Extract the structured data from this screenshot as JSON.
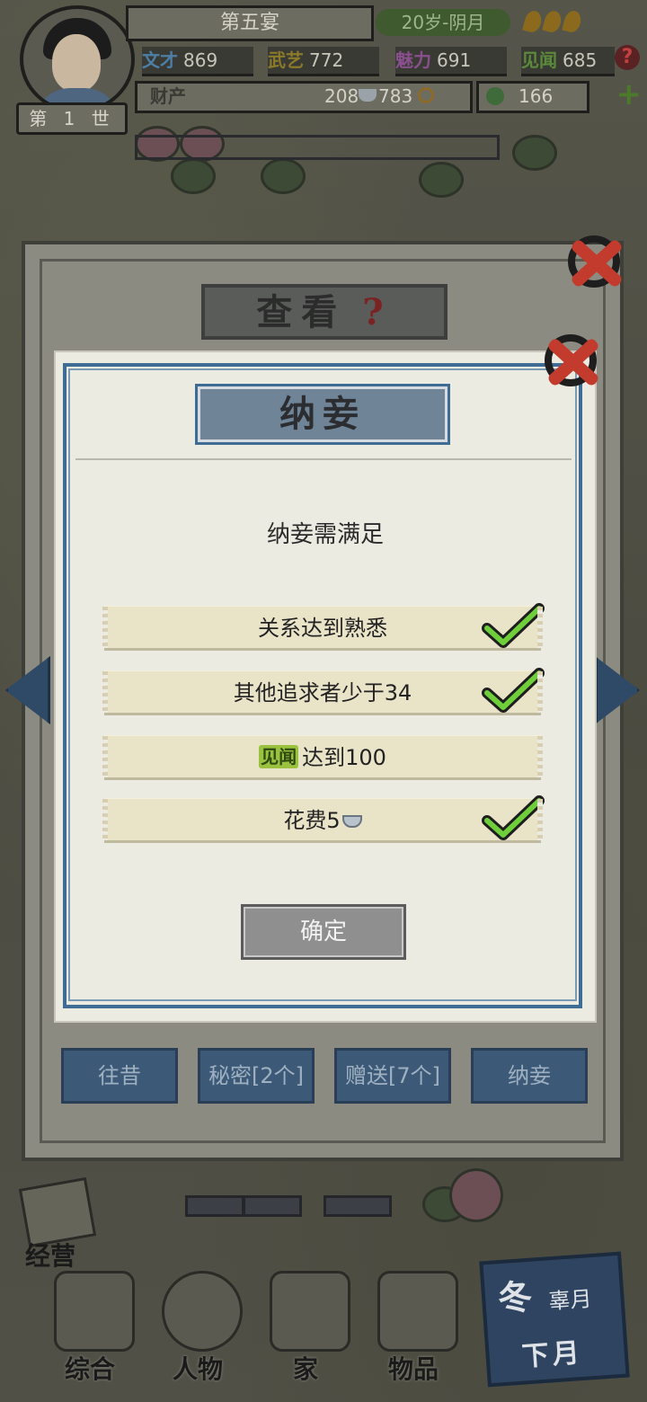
{
  "hud": {
    "generation": "第 1 世",
    "title": "第五宴",
    "age": "20岁-阴月",
    "stats": [
      {
        "label": "文才",
        "value": "869"
      },
      {
        "label": "武艺",
        "value": "772"
      },
      {
        "label": "魅力",
        "value": "691"
      },
      {
        "label": "见闻",
        "value": "685"
      }
    ],
    "wealth_label": "财产",
    "silver": "208",
    "copper": "783",
    "jade": "166",
    "help_glyph": "?",
    "plus_glyph": "+"
  },
  "view_panel": {
    "title": "查看",
    "help_glyph": "?",
    "tabs": [
      "往昔",
      "秘密[2个]",
      "赠送[7个]",
      "纳妾"
    ]
  },
  "dialog": {
    "title": "纳妾",
    "subtitle": "纳妾需满足",
    "conditions": [
      {
        "text": "关系达到熟悉",
        "met": true
      },
      {
        "text": "其他追求者少于34",
        "met": true
      },
      {
        "tag": "见闻",
        "text": "达到100",
        "met": false
      },
      {
        "text": "花费5",
        "met": true,
        "icon": "silver-ingot-icon"
      }
    ],
    "confirm_label": "确定"
  },
  "bottom_nav": {
    "jingying": "经营",
    "items": [
      "综合",
      "人物",
      "家",
      "物品"
    ],
    "season": "冬",
    "month": "辜月",
    "next_month": "下月"
  },
  "colors": {
    "accent_blue": "#3f6c94",
    "check_green": "#6fcf3a",
    "close_red": "#c23b2c"
  }
}
